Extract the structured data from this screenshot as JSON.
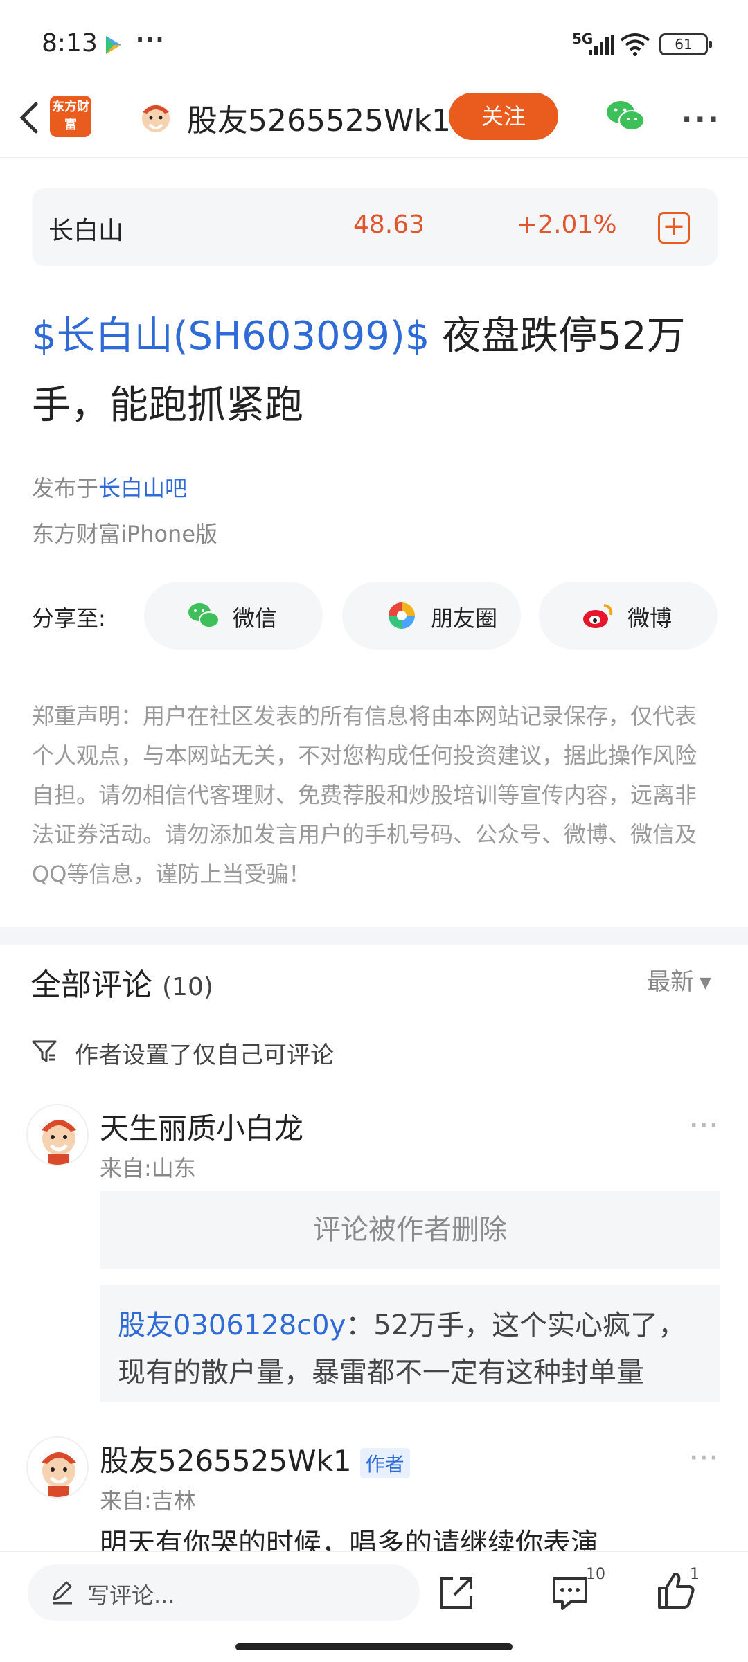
{
  "status_bar": {
    "time": "8:13",
    "dots": "···",
    "network": "5G",
    "battery": "61"
  },
  "header": {
    "app_logo_text": "东方财富",
    "author_name": "股友5265525Wk1",
    "follow_label": "关注",
    "more": "···"
  },
  "stock": {
    "name": "长白山",
    "price": "48.63",
    "change": "+2.01%",
    "add": "+",
    "color": "#e0562e"
  },
  "post": {
    "stock_tag": "$长白山(SH603099)$",
    "title_rest": " 夜盘跌停52万手，能跑抓紧跑",
    "published_prefix": "发布于",
    "forum": "长白山吧",
    "source": "东方财富iPhone版"
  },
  "share": {
    "label": "分享至:",
    "buttons": [
      {
        "label": "微信",
        "icon": "wechat-icon"
      },
      {
        "label": "朋友圈",
        "icon": "moments-icon"
      },
      {
        "label": "微博",
        "icon": "weibo-icon"
      }
    ]
  },
  "disclaimer": "郑重声明：用户在社区发表的所有信息将由本网站记录保存，仅代表个人观点，与本网站无关，不对您构成任何投资建议，据此操作风险自担。请勿相信代客理财、免费荐股和炒股培训等宣传内容，远离非法证券活动。请勿添加发言用户的手机号码、公众号、微博、微信及QQ等信息，谨防上当受骗！",
  "comments": {
    "title": "全部评论",
    "count": "(10)",
    "sort": "最新",
    "restriction": "作者设置了仅自己可评论",
    "items": [
      {
        "user": "天生丽质小白龙",
        "location": "来自:山东",
        "deleted_text": "评论被作者删除",
        "quote_user": "股友0306128c0y",
        "quote_text": "：52万手，这个实心疯了，现有的散户量，暴雷都不一定有这种封单量"
      },
      {
        "user": "股友5265525Wk1",
        "tag": "作者",
        "location": "来自:吉林",
        "text": "明天有你哭的时候，唱多的请继续你表演"
      }
    ]
  },
  "bottom_bar": {
    "input_placeholder": "写评论...",
    "comment_count": "10",
    "like_count": "1"
  },
  "colors": {
    "accent": "#ea5b1e",
    "link": "#2f6bd6",
    "up": "#e0562e"
  }
}
